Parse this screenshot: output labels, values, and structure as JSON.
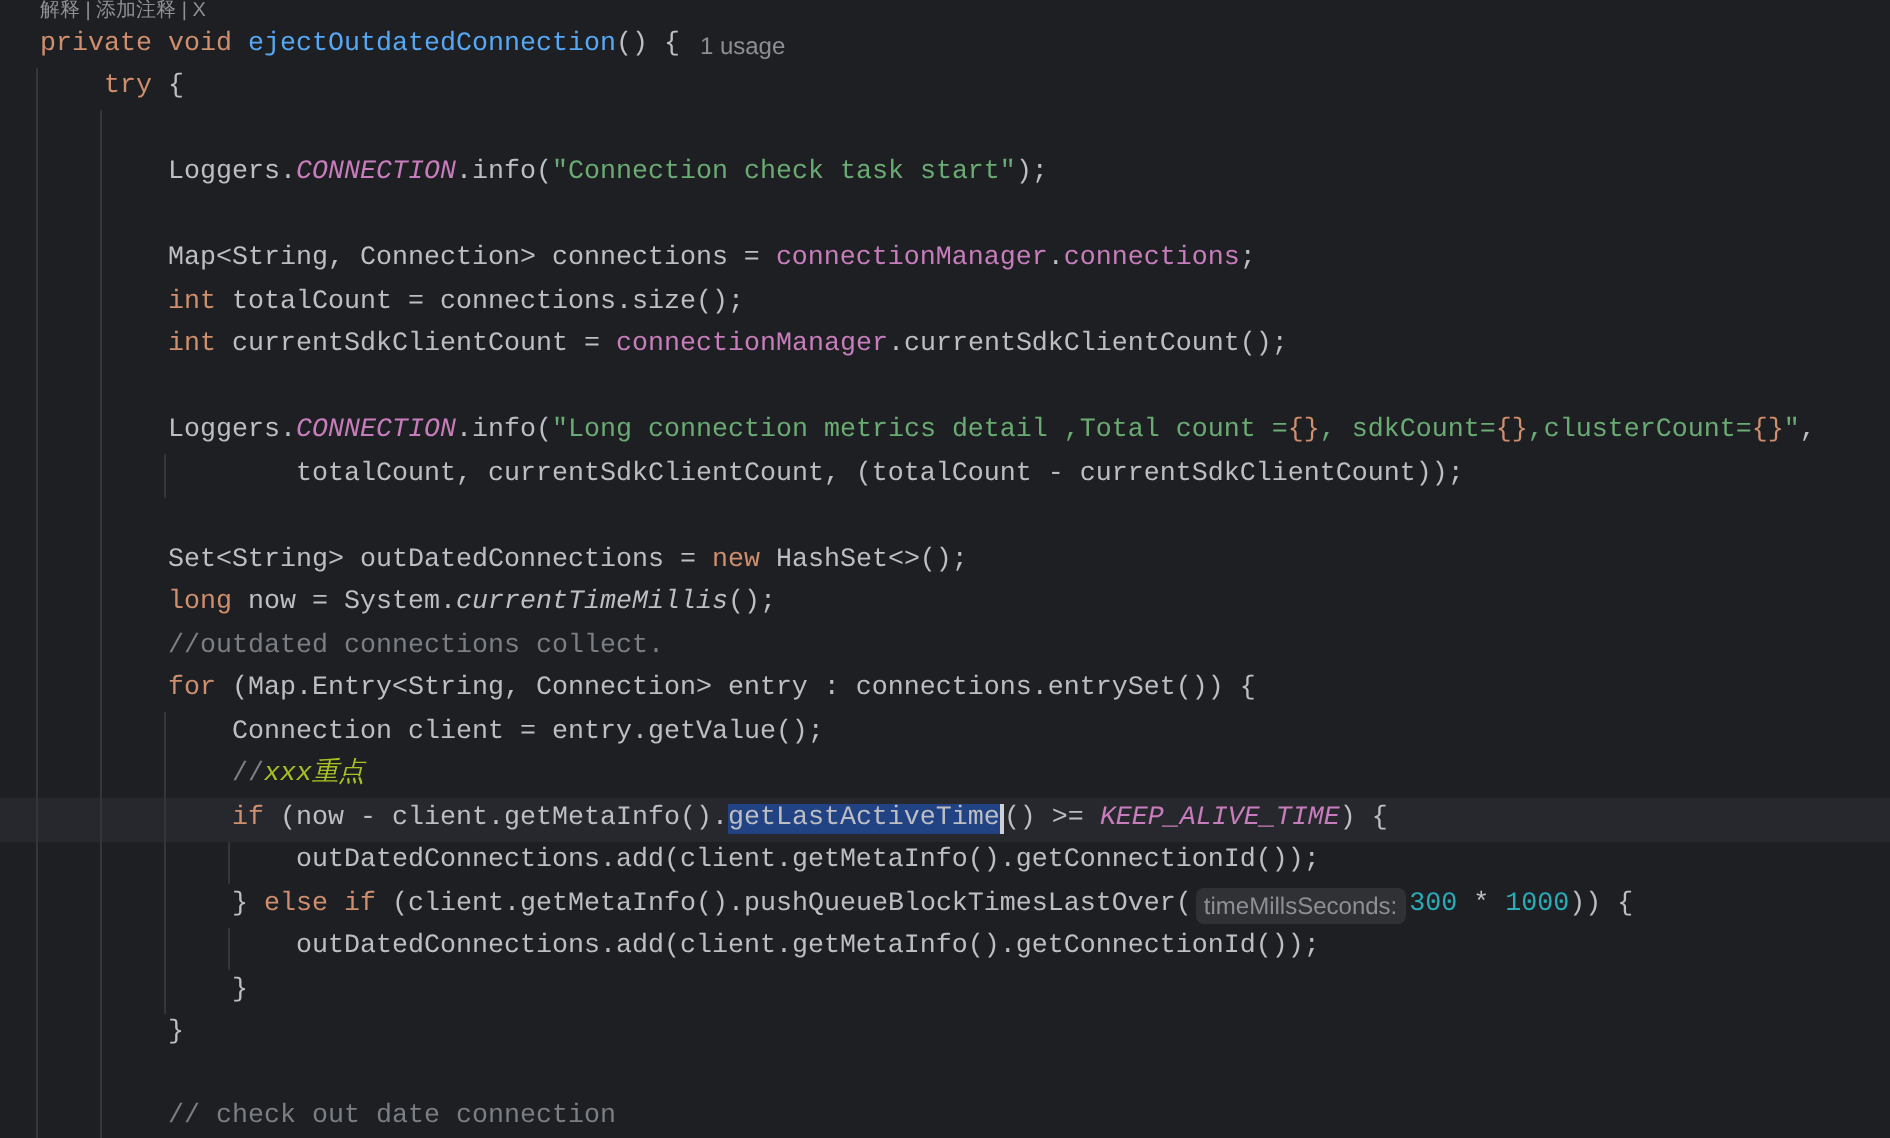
{
  "code_vision": "解释 | 添加注释 | X",
  "lines": [
    {
      "current": false,
      "tokens": [
        {
          "kind": "keyword",
          "text": "private void "
        },
        {
          "kind": "declaration",
          "text": "ejectOutdatedConnection"
        },
        {
          "kind": "plain",
          "text": "() {"
        },
        {
          "kind": "usage",
          "text": "1 usage"
        }
      ],
      "children": [
        {
          "current": false,
          "tokens": [
            {
              "kind": "keyword",
              "text": "try"
            },
            {
              "kind": "plain",
              "text": " {"
            }
          ],
          "children": [
            {
              "current": false
            },
            {
              "current": false,
              "tokens": [
                {
                  "kind": "plain",
                  "text": "Loggers."
                },
                {
                  "kind": "field",
                  "text": "CONNECTION"
                },
                {
                  "kind": "plain",
                  "text": ".info("
                },
                {
                  "kind": "string",
                  "text": "\"Connection check task start\""
                },
                {
                  "kind": "plain",
                  "text": ");"
                }
              ]
            },
            {
              "current": false
            },
            {
              "current": false,
              "tokens": [
                {
                  "kind": "plain",
                  "text": "Map<String, Connection> connections = "
                },
                {
                  "kind": "member",
                  "text": "connectionManager"
                },
                {
                  "kind": "plain",
                  "text": "."
                },
                {
                  "kind": "member",
                  "text": "connections"
                },
                {
                  "kind": "plain",
                  "text": ";"
                }
              ]
            },
            {
              "current": false,
              "tokens": [
                {
                  "kind": "keyword",
                  "text": "int "
                },
                {
                  "kind": "plain",
                  "text": "totalCount = connections.size();"
                }
              ]
            },
            {
              "current": false,
              "tokens": [
                {
                  "kind": "keyword",
                  "text": "int "
                },
                {
                  "kind": "plain",
                  "text": "currentSdkClientCount = "
                },
                {
                  "kind": "member",
                  "text": "connectionManager"
                },
                {
                  "kind": "plain",
                  "text": ".currentSdkClientCount();"
                }
              ]
            },
            {
              "current": false
            },
            {
              "current": false,
              "tokens": [
                {
                  "kind": "plain",
                  "text": "Loggers."
                },
                {
                  "kind": "field",
                  "text": "CONNECTION"
                },
                {
                  "kind": "plain",
                  "text": ".info("
                },
                {
                  "kind": "string",
                  "text": "\"Long connection metrics detail ,Total count ="
                },
                {
                  "kind": "brace",
                  "text": "{}"
                },
                {
                  "kind": "string",
                  "text": ", sdkCount="
                },
                {
                  "kind": "brace",
                  "text": "{}"
                },
                {
                  "kind": "string",
                  "text": ",clusterCount="
                },
                {
                  "kind": "brace",
                  "text": "{}"
                },
                {
                  "kind": "string",
                  "text": "\""
                },
                {
                  "kind": "plain",
                  "text": ","
                }
              ],
              "continuation": {
                "tokens": [
                  {
                    "kind": "plain",
                    "text": "totalCount, currentSdkClientCount, (totalCount - currentSdkClientCount));"
                  }
                ]
              }
            },
            {
              "current": false
            },
            {
              "current": false,
              "tokens": [
                {
                  "kind": "plain",
                  "text": "Set<String> outDatedConnections = "
                },
                {
                  "kind": "keyword",
                  "text": "new "
                },
                {
                  "kind": "plain",
                  "text": "HashSet<>();"
                }
              ]
            },
            {
              "current": false,
              "tokens": [
                {
                  "kind": "keyword",
                  "text": "long "
                },
                {
                  "kind": "plain",
                  "text": "now = System."
                },
                {
                  "kind": "static",
                  "text": "currentTimeMillis"
                },
                {
                  "kind": "plain",
                  "text": "();"
                }
              ]
            },
            {
              "current": false,
              "tokens": [
                {
                  "kind": "comment",
                  "text": "//outdated connections collect."
                }
              ]
            },
            {
              "current": false,
              "tokens": [
                {
                  "kind": "keyword",
                  "text": "for "
                },
                {
                  "kind": "plain",
                  "text": "(Map.Entry<String, Connection> entry : connections.entrySet()) {"
                }
              ],
              "children": [
                {
                  "current": false,
                  "tokens": [
                    {
                      "kind": "plain",
                      "text": "Connection client = entry.getValue();"
                    }
                  ]
                },
                {
                  "current": false,
                  "tokens": [
                    {
                      "kind": "comment",
                      "text": "//"
                    },
                    {
                      "kind": "todo",
                      "text": "xxx重点"
                    }
                  ]
                },
                {
                  "current": true,
                  "tokens": [
                    {
                      "kind": "keyword",
                      "text": "if "
                    },
                    {
                      "kind": "plain",
                      "text": "(now - client.getMetaInfo()."
                    },
                    {
                      "kind": "selection",
                      "text": "getLastActiveTime"
                    },
                    {
                      "kind": "plain",
                      "text": "() >= "
                    },
                    {
                      "kind": "field",
                      "text": "KEEP_ALIVE_TIME"
                    },
                    {
                      "kind": "plain",
                      "text": ") {"
                    }
                  ],
                  "children": [
                    {
                      "current": false,
                      "tokens": [
                        {
                          "kind": "plain",
                          "text": "outDatedConnections.add(client.getMetaInfo().getConnectionId());"
                        }
                      ]
                    }
                  ]
                },
                {
                  "current": false,
                  "tokens": [
                    {
                      "kind": "plain",
                      "text": "} "
                    },
                    {
                      "kind": "keyword",
                      "text": "else if "
                    },
                    {
                      "kind": "plain",
                      "text": "(client.getMetaInfo().pushQueueBlockTimesLastOver("
                    },
                    {
                      "kind": "inlay",
                      "text": "timeMillsSeconds:"
                    },
                    {
                      "kind": "number",
                      "text": "300"
                    },
                    {
                      "kind": "plain",
                      "text": " * "
                    },
                    {
                      "kind": "number",
                      "text": "1000"
                    },
                    {
                      "kind": "plain",
                      "text": ")) {"
                    }
                  ],
                  "children": [
                    {
                      "current": false,
                      "tokens": [
                        {
                          "kind": "plain",
                          "text": "outDatedConnections.add(client.getMetaInfo().getConnectionId());"
                        }
                      ]
                    }
                  ]
                },
                {
                  "current": false,
                  "tokens": [
                    {
                      "kind": "plain",
                      "text": "}"
                    }
                  ]
                }
              ]
            },
            {
              "current": false,
              "tokens": [
                {
                  "kind": "plain",
                  "text": "}"
                }
              ]
            },
            {
              "current": false
            },
            {
              "current": false,
              "tokens": [
                {
                  "kind": "comment",
                  "text": "// check out date connection"
                }
              ]
            }
          ]
        }
      ]
    }
  ]
}
